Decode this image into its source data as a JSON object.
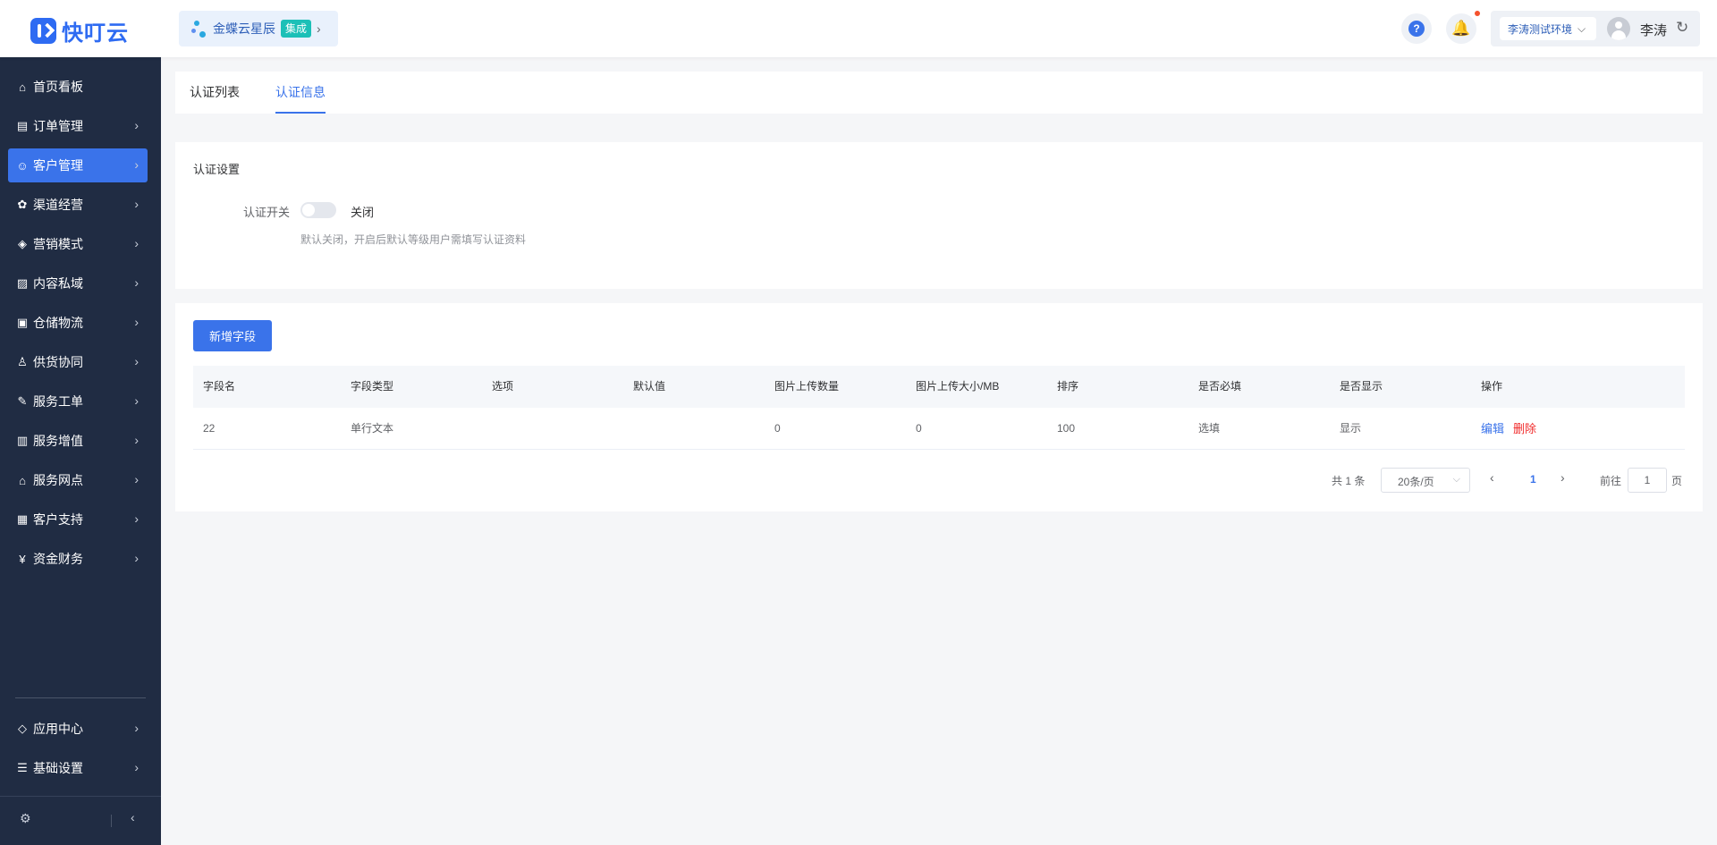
{
  "header": {
    "logo_text": "快叮云",
    "product_name": "金蝶云星辰",
    "product_badge": "集成",
    "help_icon_glyph": "?",
    "env_select": "李涛测试环境",
    "user_name": "李涛"
  },
  "sidebar": {
    "items": [
      {
        "label": "首页看板",
        "icon": "home-icon",
        "glyph": "⌂",
        "has_chevron": false
      },
      {
        "label": "订单管理",
        "icon": "order-icon",
        "glyph": "▤",
        "has_chevron": true
      },
      {
        "label": "客户管理",
        "icon": "user-icon",
        "glyph": "☺",
        "has_chevron": true,
        "active": true
      },
      {
        "label": "渠道经营",
        "icon": "channel-icon",
        "glyph": "✿",
        "has_chevron": true
      },
      {
        "label": "营销模式",
        "icon": "tag-icon",
        "glyph": "◈",
        "has_chevron": true
      },
      {
        "label": "内容私域",
        "icon": "image-icon",
        "glyph": "▨",
        "has_chevron": true
      },
      {
        "label": "仓储物流",
        "icon": "warehouse-icon",
        "glyph": "▣",
        "has_chevron": true
      },
      {
        "label": "供货协同",
        "icon": "supply-icon",
        "glyph": "♙",
        "has_chevron": true
      },
      {
        "label": "服务工单",
        "icon": "ticket-icon",
        "glyph": "✎",
        "has_chevron": true
      },
      {
        "label": "服务增值",
        "icon": "bag-icon",
        "glyph": "▥",
        "has_chevron": true
      },
      {
        "label": "服务网点",
        "icon": "store-icon",
        "glyph": "⌂",
        "has_chevron": true
      },
      {
        "label": "客户支持",
        "icon": "support-icon",
        "glyph": "▦",
        "has_chevron": true
      },
      {
        "label": "资金财务",
        "icon": "yuan-icon",
        "glyph": "¥",
        "has_chevron": true
      }
    ],
    "bottom_items": [
      {
        "label": "应用中心",
        "icon": "cube-icon",
        "glyph": "◇",
        "has_chevron": true
      },
      {
        "label": "基础设置",
        "icon": "settings-sliders-icon",
        "glyph": "☰",
        "has_chevron": true
      }
    ]
  },
  "tabs": [
    {
      "label": "认证列表",
      "active": false
    },
    {
      "label": "认证信息",
      "active": true
    }
  ],
  "settings": {
    "section_title": "认证设置",
    "switch_label": "认证开关",
    "switch_state": "关闭",
    "switch_on": false,
    "hint": "默认关闭，开启后默认等级用户需填写认证资料"
  },
  "fields": {
    "add_button": "新增字段",
    "columns": [
      "字段名",
      "字段类型",
      "选项",
      "默认值",
      "图片上传数量",
      "图片上传大小/MB",
      "排序",
      "是否必填",
      "是否显示",
      "操作"
    ],
    "rows": [
      {
        "name": "22",
        "type": "单行文本",
        "options": "",
        "default": "",
        "image_count": "0",
        "image_size": "0",
        "sort": "100",
        "required": "选填",
        "visible": "显示",
        "edit": "编辑",
        "delete": "删除"
      }
    ]
  },
  "pagination": {
    "total": "共 1 条",
    "page_size": "20条/页",
    "current_page": "1",
    "goto_label": "前往",
    "goto_value": "1",
    "goto_unit": "页"
  },
  "colors": {
    "primary": "#3a73ea",
    "sidebar_bg": "#202c43",
    "danger": "#f02b2b",
    "badge": "#1cc0b7"
  }
}
